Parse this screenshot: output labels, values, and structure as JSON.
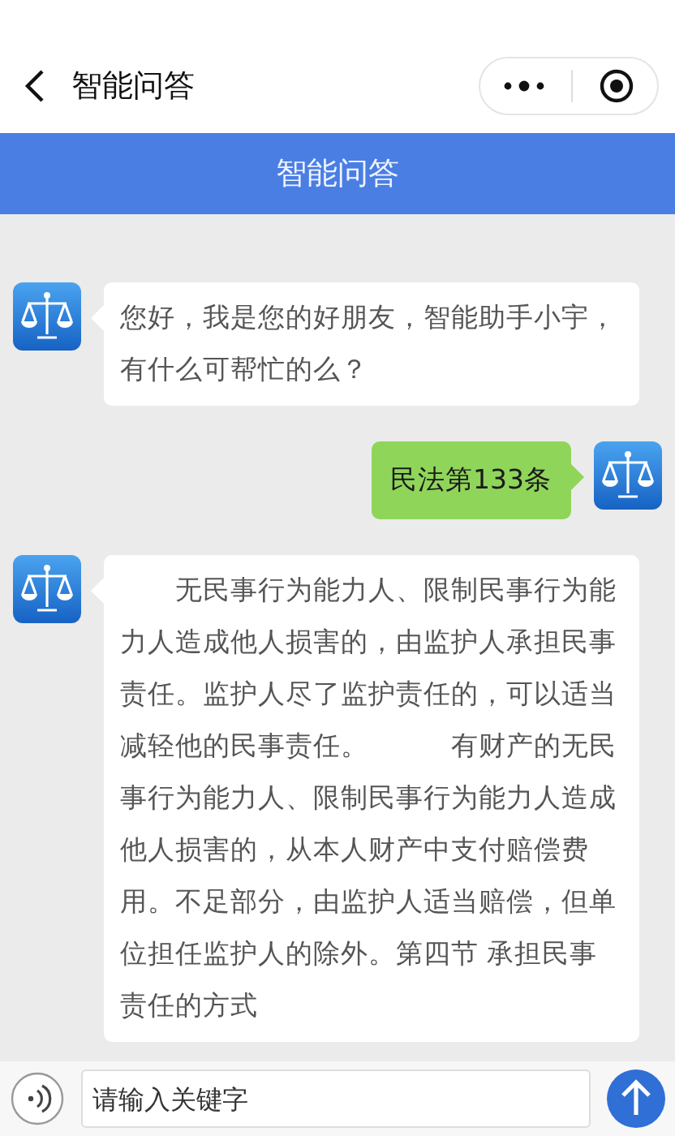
{
  "nav": {
    "title": "智能问答"
  },
  "banner": {
    "title": "智能问答"
  },
  "messages": [
    {
      "kind": "bot",
      "text": "您好，我是您的好朋友，智能助手小宇，有什么可帮忙的么？"
    },
    {
      "kind": "user",
      "text": "民法第133条"
    },
    {
      "kind": "bot",
      "text": "　　无民事行为能力人、限制民事行为能力人造成他人损害的，由监护人承担民事责任。监护人尽了监护责任的，可以适当减轻他的民事责任。　　　有财产的无民事行为能力人、限制民事行为能力人造成他人损害的，从本人财产中支付赔偿费用。不足部分，由监护人适当赔偿，但单位担任监护人的除外。第四节 承担民事责任的方式"
    }
  ],
  "input": {
    "placeholder": "请输入关键字"
  }
}
